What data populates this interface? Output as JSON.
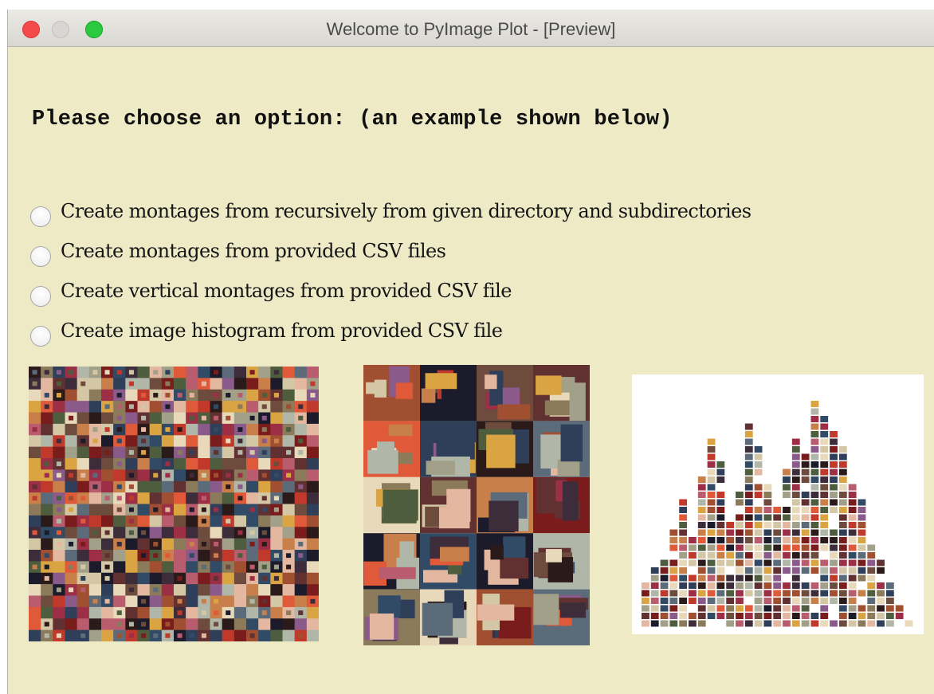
{
  "window": {
    "title": "Welcome to PyImage Plot - [Preview]"
  },
  "prompt": "Please choose an option: (an example shown below)",
  "options": [
    {
      "label": "Create montages from recursively from given directory and subdirectories",
      "selected": false
    },
    {
      "label": "Create montages from provided CSV files",
      "selected": false
    },
    {
      "label": "Create vertical montages from provided CSV file",
      "selected": false
    },
    {
      "label": "Create image histogram from provided CSV file",
      "selected": false
    }
  ],
  "colors": {
    "background": "#efeac6",
    "close": "#f34b4a",
    "minimize": "#d8d6d2",
    "maximize": "#2bc940"
  },
  "previews": [
    {
      "icon": "montage-grid-preview"
    },
    {
      "icon": "vertical-montage-preview"
    },
    {
      "icon": "image-histogram-preview"
    }
  ]
}
